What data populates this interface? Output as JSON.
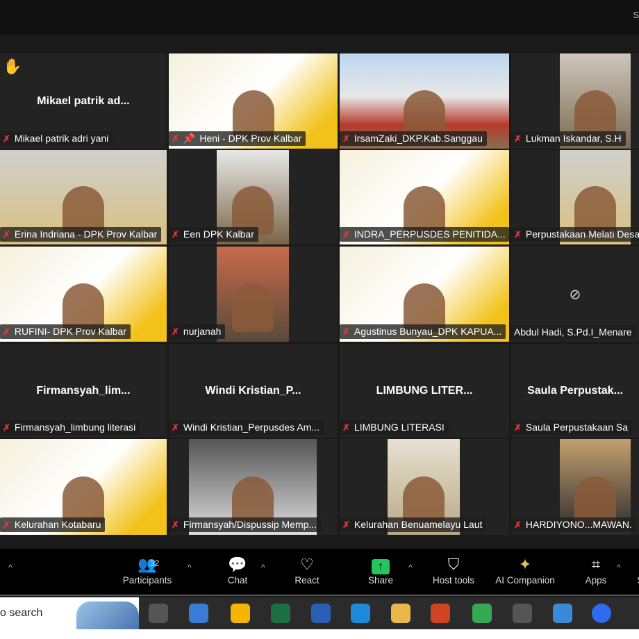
{
  "window": {
    "top_right_char": "S"
  },
  "tiles": [
    {
      "label": "Mikael patrik adri yani",
      "big": "Mikael  patrik  ad...",
      "hand": "✋"
    },
    {
      "label": "Heni - DPK Prov Kalbar",
      "pinned": true
    },
    {
      "label": "IrsamZaki_DKP.Kab.Sanggau"
    },
    {
      "label": "Lukman Iskandar, S.H"
    },
    {
      "label": "Erina Indriana - DPK Prov Kalbar"
    },
    {
      "label": "Een DPK Kalbar"
    },
    {
      "label": "INDRA_PERPUSDES PENITIDA..."
    },
    {
      "label": "Perpustakaan Melati Desa"
    },
    {
      "label": "RUFINI- DPK Prov Kalbar"
    },
    {
      "label": "nurjanah"
    },
    {
      "label": "Agustinus Bunyau_DPK KAPUA..."
    },
    {
      "label": "Abdul Hadi, S.Pd.I_Menare"
    },
    {
      "label": "Firmansyah_limbung literasi",
      "big": "Firmansyah_lim..."
    },
    {
      "label": "Windi Kristian_Perpusdes Am...",
      "big": "Windi  Kristian_P..."
    },
    {
      "label": "LIMBUNG LITERASI",
      "big": "LIMBUNG  LITER..."
    },
    {
      "label": "Saula Perpustakaan Sa",
      "big": "Saula  Perpustak..."
    },
    {
      "label": "Kelurahan Kotabaru"
    },
    {
      "label": "Firmansyah/Dispussip Memp..."
    },
    {
      "label": "Kelurahan Benuamelayu Laut"
    },
    {
      "label": "HARDIYONO...MAWAN."
    }
  ],
  "toolbar": {
    "participants": {
      "label": "Participants",
      "count": "32"
    },
    "chat": "Chat",
    "react": "React",
    "share": "Share",
    "host_tools": "Host tools",
    "ai_companion": "AI Companion",
    "apps": "Apps",
    "more_partial": "S",
    "share_color": "#22c55e"
  },
  "taskbar": {
    "search": "o search",
    "apps": [
      "Task View",
      "Microsoft Store",
      "Google Drive",
      "Excel",
      "Word",
      "Edge",
      "File Explorer",
      "PowerPoint",
      "Chrome",
      "Audio app",
      "Photos",
      "Zoom"
    ]
  }
}
